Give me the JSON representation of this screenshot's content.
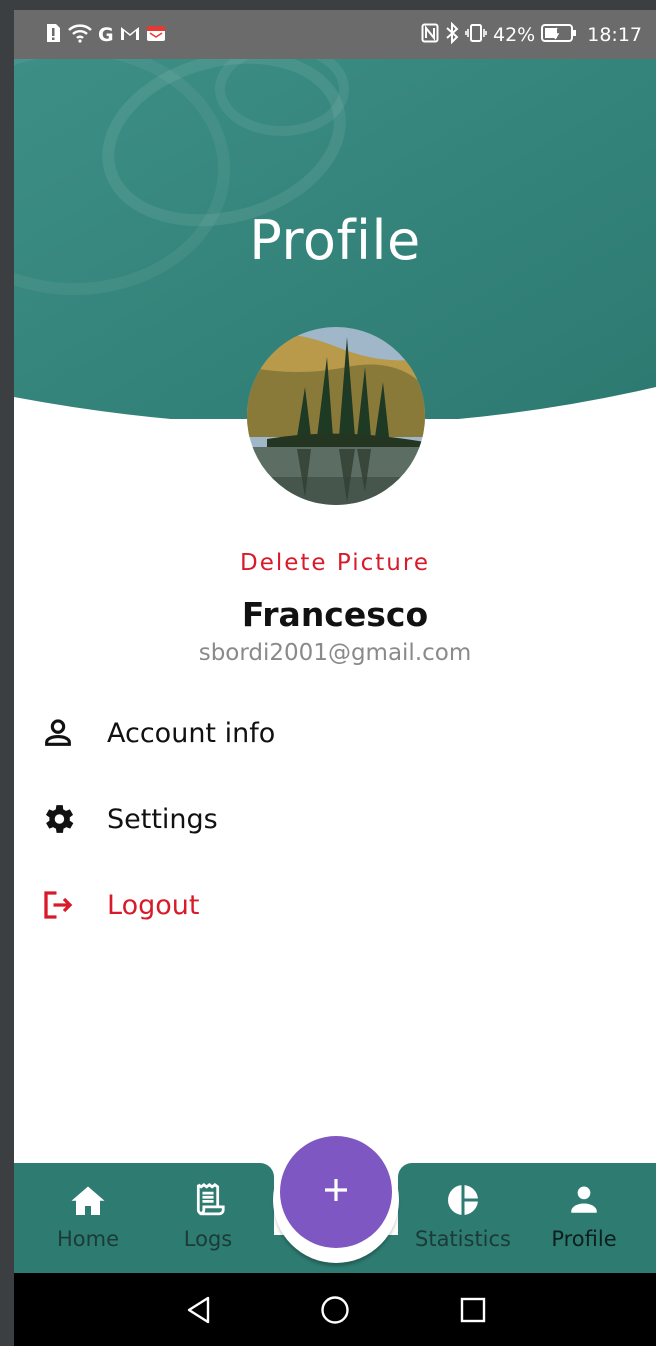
{
  "status_bar": {
    "battery_percent": "42%",
    "time": "18:17",
    "left_icons": [
      "alert-icon",
      "wifi-icon",
      "google-icon",
      "gmail-icon",
      "calendar-app-icon"
    ],
    "right_icons": [
      "nfc-icon",
      "bluetooth-icon",
      "vibrate-icon",
      "battery-icon"
    ]
  },
  "header": {
    "title": "Profile",
    "color": "#2e7b72"
  },
  "profile": {
    "delete_picture_label": "Delete Picture",
    "name": "Francesco",
    "email": "sbordi2001@gmail.com"
  },
  "menu": {
    "items": [
      {
        "label": "Account info",
        "icon": "person-outline-icon"
      },
      {
        "label": "Settings",
        "icon": "gear-icon"
      },
      {
        "label": "Logout",
        "icon": "logout-icon",
        "color": "#d81b2a"
      }
    ]
  },
  "bottom_nav": {
    "items": [
      {
        "label": "Home",
        "icon": "home-icon"
      },
      {
        "label": "Logs",
        "icon": "receipt-icon"
      },
      {
        "label": "Statistics",
        "icon": "pie-chart-icon"
      },
      {
        "label": "Profile",
        "icon": "person-icon",
        "active": true
      }
    ],
    "fab_icon": "plus-icon",
    "fab_color": "#7e57c2"
  },
  "system_nav": {
    "buttons": [
      "back-icon",
      "home-circle-icon",
      "recents-icon"
    ]
  }
}
